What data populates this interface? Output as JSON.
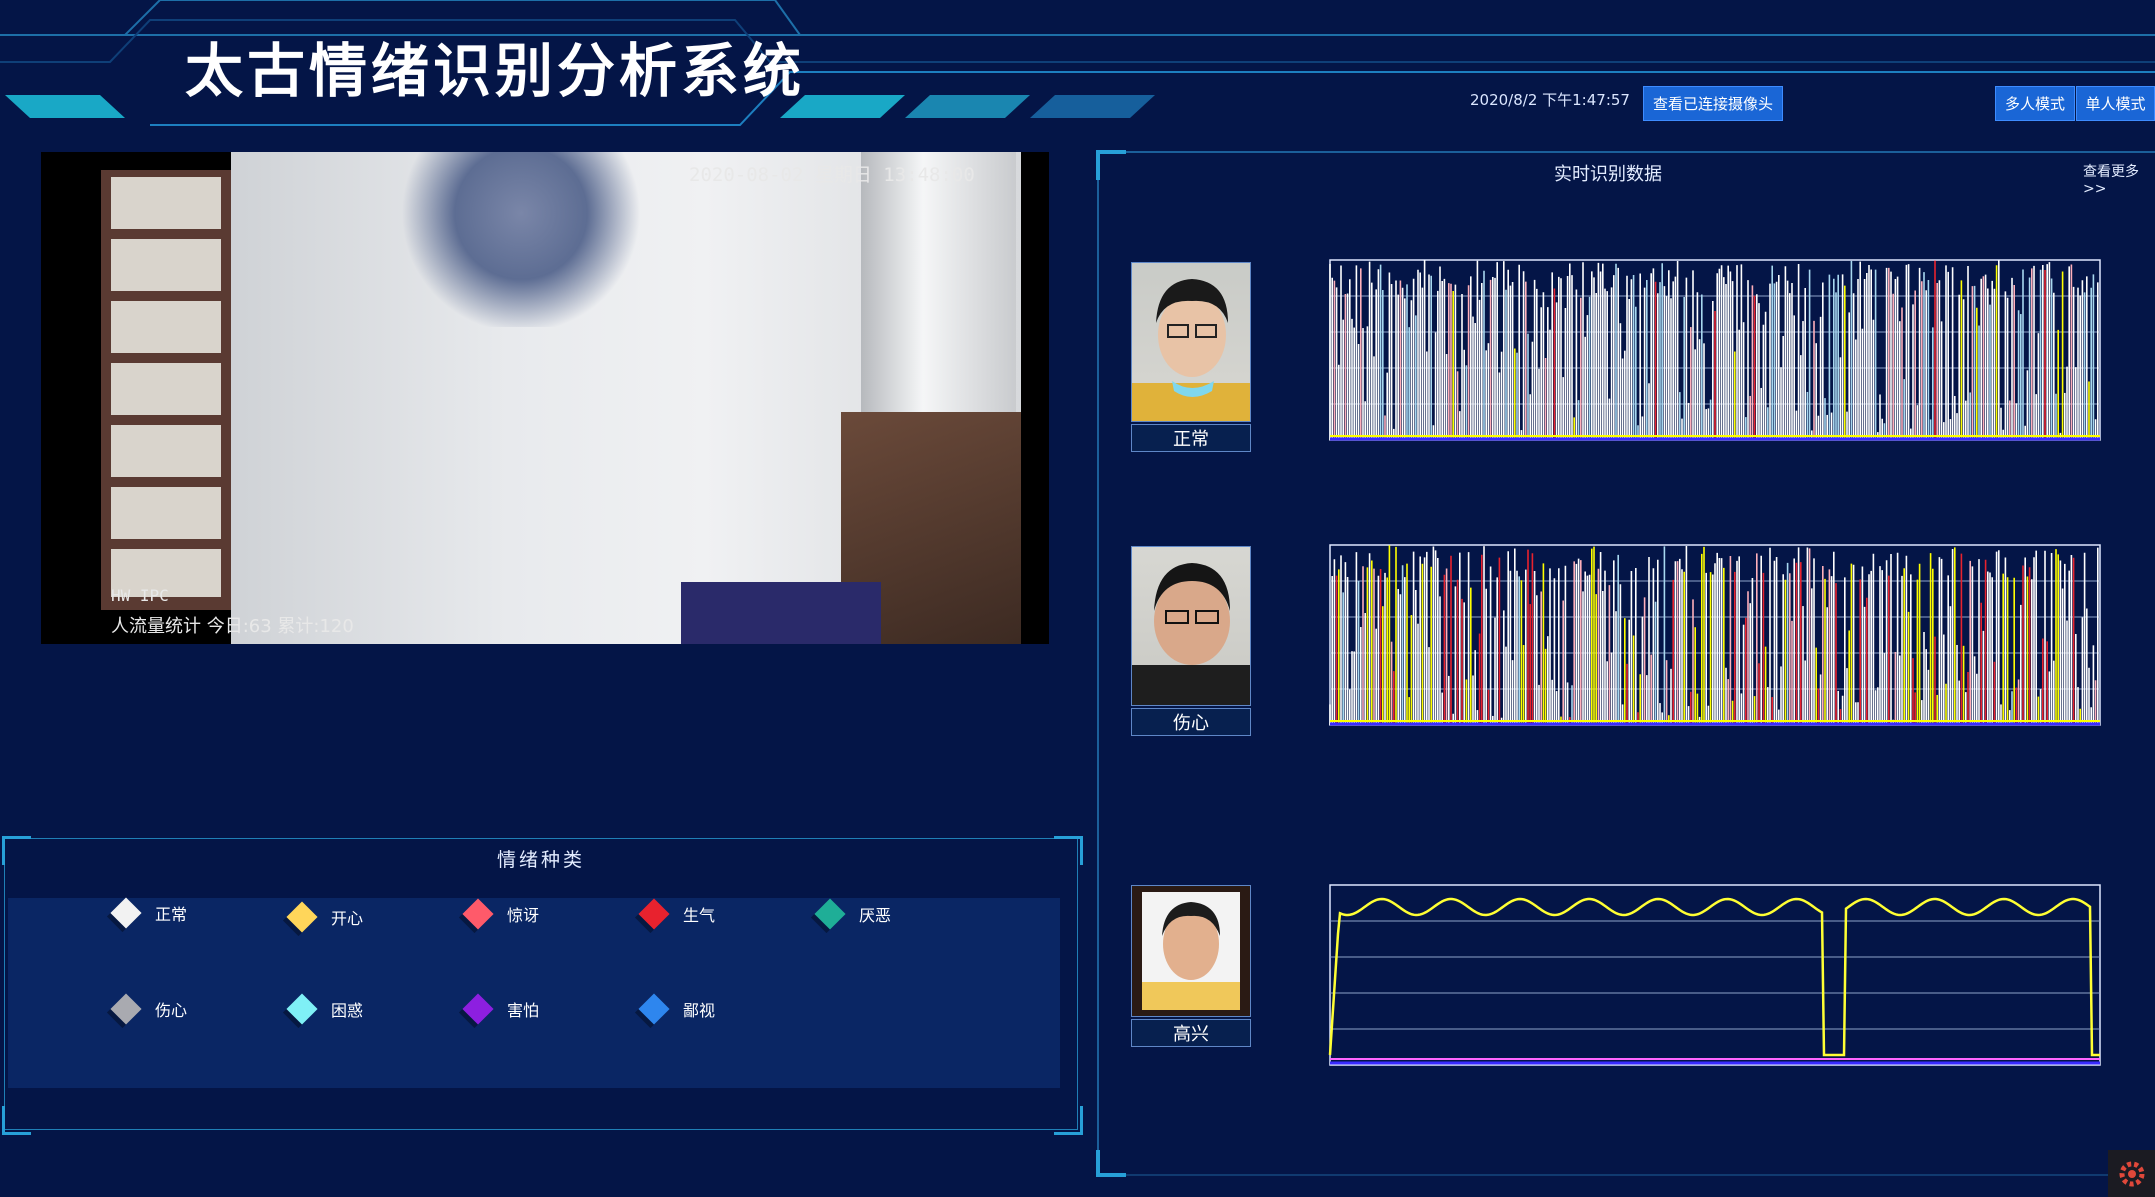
{
  "header": {
    "title": "太古情绪识别分析系统",
    "datetime": "2020/8/2 下午1:47:57",
    "view_cameras_label": "查看已连接摄像头",
    "multi_mode_label": "多人模式",
    "single_mode_label": "单人模式"
  },
  "video": {
    "timestamp": "2020-08-02 星期日 13:48:00",
    "ipc_label": "HW IPC",
    "traffic_stats": "人流量统计 今日:63 累计:120"
  },
  "emotion_panel": {
    "title": "情绪种类",
    "items": [
      {
        "label": "正常",
        "color": "#f2f2f2"
      },
      {
        "label": "开心",
        "color": "#ffd65a"
      },
      {
        "label": "惊讶",
        "color": "#ff5a6a"
      },
      {
        "label": "生气",
        "color": "#e8222e"
      },
      {
        "label": "厌恶",
        "color": "#1fae97"
      },
      {
        "label": "伤心",
        "color": "#a9aab0"
      },
      {
        "label": "困惑",
        "color": "#7ff0f6"
      },
      {
        "label": "害怕",
        "color": "#8d1fe0"
      },
      {
        "label": "鄙视",
        "color": "#2e86ee"
      }
    ]
  },
  "right_panel": {
    "title": "实时识别数据",
    "more_label": "查看更多>>",
    "persons": [
      {
        "label": "正常"
      },
      {
        "label": "伤心"
      },
      {
        "label": "高兴"
      }
    ]
  },
  "colors": {
    "background": "#041547",
    "frame_line": "#1d7fc0",
    "button": "#1a66d6",
    "line_normal": "#ffffff",
    "line_happy": "#ffff00",
    "line_sad": "#aeb8c6",
    "line_confused": "#9fd3ee",
    "line_angry": "#e8222e",
    "line_surprise": "#ff9aa6"
  }
}
